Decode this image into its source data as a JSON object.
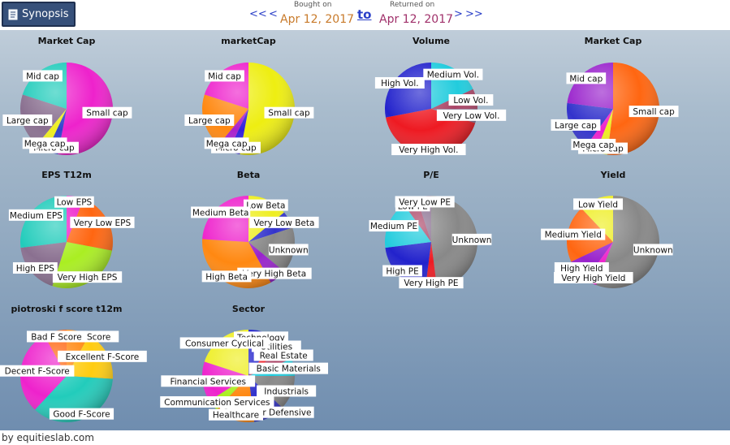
{
  "header": {
    "synopsis_label": "Synopsis",
    "nav_prev_far": "<<",
    "nav_prev": "<",
    "bought_caption": "Bought on",
    "bought_date": "Apr 12, 2017",
    "to_label": "to",
    "returned_caption": "Returned on",
    "returned_date": "Apr 12, 2017",
    "nav_next": ">",
    "nav_next_far": ">>"
  },
  "footer": {
    "credit": "by equitieslab.com"
  },
  "colors": {
    "accent_link": "#2a3fc8",
    "date_bought": "#c87a2a",
    "date_returned": "#a0306a",
    "synopsis_bg": "#36507a"
  },
  "chart_data": [
    {
      "type": "pie",
      "title": "Market Cap",
      "slices": [
        {
          "label": "Small cap",
          "value": 53,
          "color": "#ee22cc"
        },
        {
          "label": "Micro cap",
          "value": 4,
          "color": "#3344cc"
        },
        {
          "label": "Mega cap",
          "value": 4,
          "color": "#eeee22"
        },
        {
          "label": "Large cap",
          "value": 19,
          "color": "#8a7090"
        },
        {
          "label": "Mid cap",
          "value": 20,
          "color": "#22ccbb"
        }
      ]
    },
    {
      "type": "pie",
      "title": "marketCap",
      "slices": [
        {
          "label": "Small cap",
          "value": 53,
          "color": "#eeee11"
        },
        {
          "label": "Micro cap",
          "value": 4,
          "color": "#3322dd"
        },
        {
          "label": "Mega cap",
          "value": 4,
          "color": "#aa22cc"
        },
        {
          "label": "Large cap",
          "value": 19,
          "color": "#ff8811"
        },
        {
          "label": "Mid cap",
          "value": 20,
          "color": "#ee22cc"
        }
      ]
    },
    {
      "type": "pie",
      "title": "Volume",
      "slices": [
        {
          "label": "Medium Vol.",
          "value": 18,
          "color": "#22ccdd"
        },
        {
          "label": "Low Vol.",
          "value": 7,
          "color": "#aa4466"
        },
        {
          "label": "Very Low Vol.",
          "value": 5,
          "color": "#8a7090"
        },
        {
          "label": "Very High Vol.",
          "value": 42,
          "color": "#ee1a22"
        },
        {
          "label": "High Vol.",
          "value": 28,
          "color": "#2222cc"
        }
      ]
    },
    {
      "type": "pie",
      "title": "Market Cap",
      "slices": [
        {
          "label": "Small cap",
          "value": 52,
          "color": "#ff6611"
        },
        {
          "label": "Micro cap",
          "value": 4,
          "color": "#eeee22"
        },
        {
          "label": "Mega cap",
          "value": 4,
          "color": "#ee22cc"
        },
        {
          "label": "Large cap",
          "value": 17,
          "color": "#3333cc"
        },
        {
          "label": "Mid cap",
          "value": 23,
          "color": "#9922cc"
        }
      ]
    },
    {
      "type": "pie",
      "title": "EPS T12m",
      "slices": [
        {
          "label": "Low EPS",
          "value": 6,
          "color": "#ee22cc"
        },
        {
          "label": "Very Low EPS",
          "value": 22,
          "color": "#ff6611"
        },
        {
          "label": "Very High EPS",
          "value": 27,
          "color": "#aaee22"
        },
        {
          "label": "High EPS",
          "value": 18,
          "color": "#8a7090"
        },
        {
          "label": "Medium EPS",
          "value": 27,
          "color": "#22ccbb"
        }
      ]
    },
    {
      "type": "pie",
      "title": "Beta",
      "slices": [
        {
          "label": "Low Beta",
          "value": 14,
          "color": "#eeee22"
        },
        {
          "label": "Very Low Beta",
          "value": 6,
          "color": "#3333cc"
        },
        {
          "label": "Unknown",
          "value": 16,
          "color": "#888888"
        },
        {
          "label": "Very High Beta",
          "value": 6,
          "color": "#9922cc"
        },
        {
          "label": "High Beta",
          "value": 34,
          "color": "#ff8811"
        },
        {
          "label": "Medium Beta",
          "value": 24,
          "color": "#ee22cc"
        }
      ]
    },
    {
      "type": "pie",
      "title": "P/E",
      "slices": [
        {
          "label": "Unknown",
          "value": 48,
          "color": "#888888"
        },
        {
          "label": "Very High PE",
          "value": 4,
          "color": "#ee1a22"
        },
        {
          "label": "High PE",
          "value": 21,
          "color": "#2222cc"
        },
        {
          "label": "Medium PE",
          "value": 17,
          "color": "#22ccdd"
        },
        {
          "label": "Low PE",
          "value": 5,
          "color": "#aa4466"
        },
        {
          "label": "Very Low PE",
          "value": 5,
          "color": "#8a7090"
        }
      ]
    },
    {
      "type": "pie",
      "title": "Yield",
      "slices": [
        {
          "label": "Unknown",
          "value": 56,
          "color": "#888888"
        },
        {
          "label": "Very High Yield",
          "value": 4,
          "color": "#ee22cc"
        },
        {
          "label": "High Yield",
          "value": 8,
          "color": "#9922cc"
        },
        {
          "label": "Medium Yield",
          "value": 20,
          "color": "#ff6611"
        },
        {
          "label": "Low Yield",
          "value": 12,
          "color": "#eeee22"
        }
      ]
    },
    {
      "type": "pie",
      "title": "piotroski f score t12m",
      "slices": [
        {
          "label": "Horrible F Score",
          "value": 8,
          "color": "#ff8811"
        },
        {
          "label": "Excellent F-Score",
          "value": 18,
          "color": "#ffcc11"
        },
        {
          "label": "Good F-Score",
          "value": 36,
          "color": "#22ccbb"
        },
        {
          "label": "Decent F-Score",
          "value": 30,
          "color": "#ee22cc"
        },
        {
          "label": "Bad F Score",
          "value": 8,
          "color": "#ff6611"
        }
      ]
    },
    {
      "type": "pie",
      "title": "Sector",
      "slices": [
        {
          "label": "Technology",
          "value": 10,
          "color": "#2222cc"
        },
        {
          "label": "Utilities",
          "value": 4,
          "color": "#ee1a22"
        },
        {
          "label": "Real Estate",
          "value": 5,
          "color": "#aa4466"
        },
        {
          "label": "Basic Materials",
          "value": 6,
          "color": "#22ccdd"
        },
        {
          "label": "Industrials",
          "value": 12,
          "color": "#888888"
        },
        {
          "label": "Consumer Defensive",
          "value": 11,
          "color": "#3333cc"
        },
        {
          "label": "Healthcare",
          "value": 14,
          "color": "#ff8811"
        },
        {
          "label": "Communication Services",
          "value": 4,
          "color": "#aaee22"
        },
        {
          "label": "Financial Services",
          "value": 14,
          "color": "#ee22cc"
        },
        {
          "label": "Consumer Cyclical",
          "value": 20,
          "color": "#eeee22"
        }
      ]
    }
  ]
}
